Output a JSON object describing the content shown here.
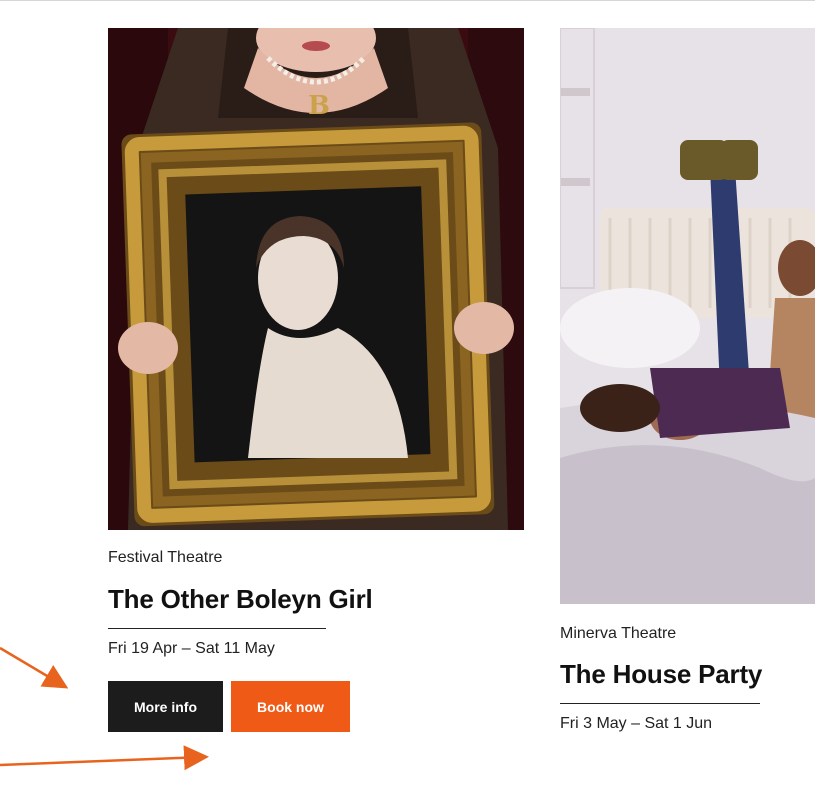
{
  "events": [
    {
      "venue": "Festival Theatre",
      "title": "The Other Boleyn Girl",
      "dates": "Fri 19 Apr – Sat 11 May",
      "more_info_label": "More info",
      "book_now_label": "Book now",
      "image_subject": "woman holding ornate gilded portrait frame"
    },
    {
      "venue": "Minerva Theatre",
      "title": "The House Party",
      "dates": "Fri 3 May – Sat 1 Jun",
      "image_subject": "women lying on bed"
    }
  ],
  "colors": {
    "book_button": "#ef5a17",
    "more_info_button": "#1c1c1c",
    "annotation_arrow": "#e8641e"
  }
}
